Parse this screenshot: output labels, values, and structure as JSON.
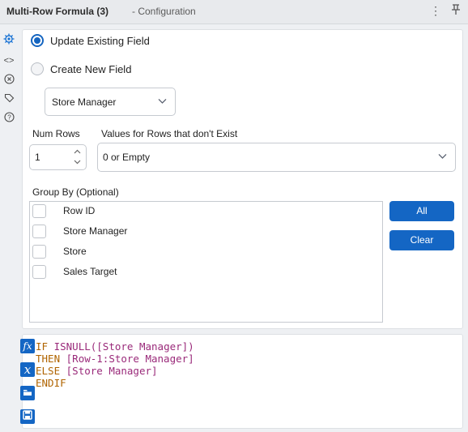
{
  "titlebar": {
    "title": "Multi-Row Formula (3)",
    "subtitle": "- Configuration",
    "menu_icon": "more-vertical-icon",
    "pin_icon": "pin-icon"
  },
  "sidebar": {
    "icons": [
      "gear-icon",
      "code-icon",
      "formula-icon",
      "tag-icon",
      "help-icon"
    ]
  },
  "config": {
    "radio_update": "Update Existing Field",
    "radio_create": "Create New  Field",
    "field_select": "Store Manager",
    "num_rows_label": "Num Rows",
    "num_rows_value": "1",
    "nonexist_label": "Values for Rows that don't Exist",
    "nonexist_value": "0 or Empty",
    "group_by_label": "Group By (Optional)",
    "group_items": [
      "Row ID",
      "Store Manager",
      "Store",
      "Sales Target"
    ],
    "all_button": "All",
    "clear_button": "Clear"
  },
  "expression": {
    "line1_kw": "IF",
    "line1_fn": "ISNULL(",
    "line1_field": "[Store Manager]",
    "line1_end": ")",
    "line2_kw": "THEN",
    "line2_field": "[Row-1:Store Manager]",
    "line3_kw": "ELSE",
    "line3_field": "[Store Manager]",
    "line4_kw": "ENDIF"
  },
  "colors": {
    "accent": "#1466c4",
    "keyword": "#b06400",
    "field": "#9a2a7a"
  }
}
